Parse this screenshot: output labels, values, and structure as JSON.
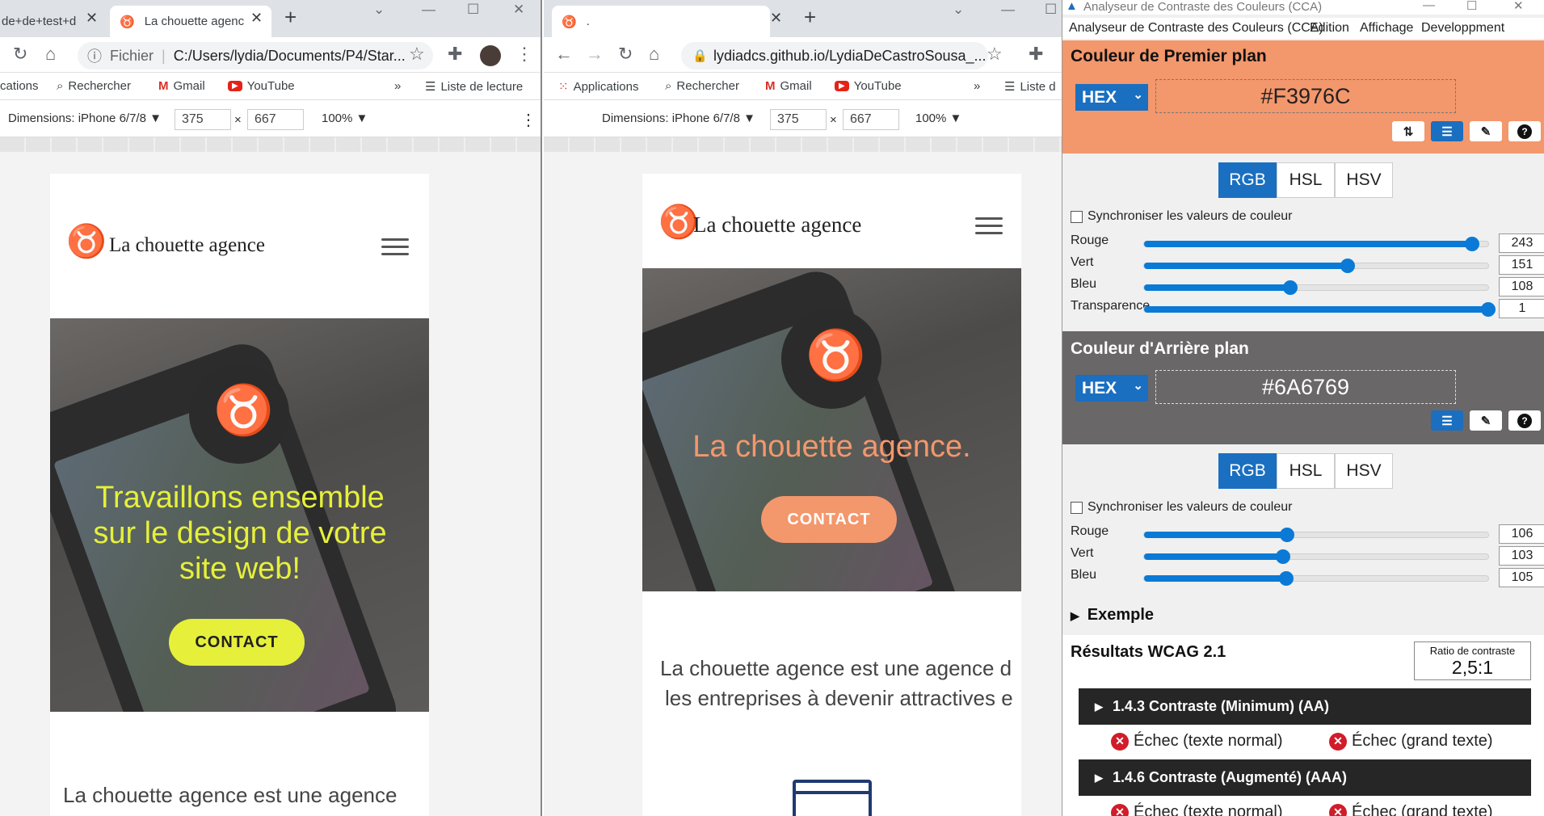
{
  "left_browser": {
    "tabs": [
      {
        "title": "de+de+test+d"
      },
      {
        "title": "La chouette agenc"
      }
    ],
    "address": {
      "scheme": "Fichier",
      "url": "C:/Users/lydia/Documents/P4/Star..."
    },
    "bookmarks": [
      "cations",
      "Rechercher",
      "Gmail",
      "YouTube",
      "Liste de lecture"
    ],
    "device": {
      "label": "Dimensions: iPhone 6/7/8 ▼",
      "width": "375",
      "height": "667",
      "zoom": "100% ▼"
    },
    "page": {
      "brand": "La chouette agence",
      "headline": "Travaillons ensemble sur le design de votre site web!",
      "cta": "CONTACT",
      "intro": "La chouette agence est une agence"
    }
  },
  "right_browser": {
    "tab_title": ".",
    "address": {
      "url": "lydiadcs.github.io/LydiaDeCastroSousa_..."
    },
    "bookmarks": [
      "Applications",
      "Rechercher",
      "Gmail",
      "YouTube",
      "Liste d"
    ],
    "device": {
      "label": "Dimensions: iPhone 6/7/8 ▼",
      "width": "375",
      "height": "667",
      "zoom": "100% ▼"
    },
    "page": {
      "brand": "La chouette agence",
      "headline": "La chouette agence.",
      "cta": "CONTACT",
      "intro_line1": "La chouette agence est une agence d",
      "intro_line2": "les entreprises à devenir attractives e"
    }
  },
  "cca": {
    "window_title": "Analyseur de Contraste des Couleurs (CCA)",
    "menu": [
      "Analyseur de Contraste des Couleurs (CCA)",
      "Edition",
      "Affichage",
      "Developpment"
    ],
    "foreground": {
      "title": "Couleur de Premier plan",
      "format": "HEX",
      "hex": "#F3976C",
      "modes": [
        "RGB",
        "HSL",
        "HSV"
      ],
      "active_mode": "RGB",
      "sync_label": "Synchroniser les valeurs de couleur",
      "channels": [
        {
          "label": "Rouge",
          "value": "243",
          "level": 0.953
        },
        {
          "label": "Vert",
          "value": "151",
          "level": 0.592
        },
        {
          "label": "Bleu",
          "value": "108",
          "level": 0.424
        },
        {
          "label": "Transparence",
          "value": "1",
          "level": 1.0
        }
      ]
    },
    "background": {
      "title": "Couleur d'Arrière plan",
      "format": "HEX",
      "hex": "#6A6769",
      "modes": [
        "RGB",
        "HSL",
        "HSV"
      ],
      "active_mode": "RGB",
      "sync_label": "Synchroniser les valeurs de couleur",
      "channels": [
        {
          "label": "Rouge",
          "value": "106",
          "level": 0.416
        },
        {
          "label": "Vert",
          "value": "103",
          "level": 0.404
        },
        {
          "label": "Bleu",
          "value": "105",
          "level": 0.412
        }
      ]
    },
    "example_label": "Exemple",
    "results_title": "Résultats WCAG 2.1",
    "ratio_label": "Ratio de contraste",
    "ratio_value": "2,5:1",
    "criteria": [
      {
        "title": "1.4.3 Contraste (Minimum) (AA)",
        "normal": "Échec (texte normal)",
        "large": "Échec (grand texte)"
      },
      {
        "title": "1.4.6 Contraste (Augmenté) (AAA)",
        "normal": "Échec (texte normal)",
        "large": "Échec (grand texte)"
      }
    ]
  },
  "colors": {
    "fg": "#F3976C",
    "bg": "#6A6769",
    "headline_yellow": "#E6F03A",
    "accent_blue": "#1A6FC0"
  }
}
